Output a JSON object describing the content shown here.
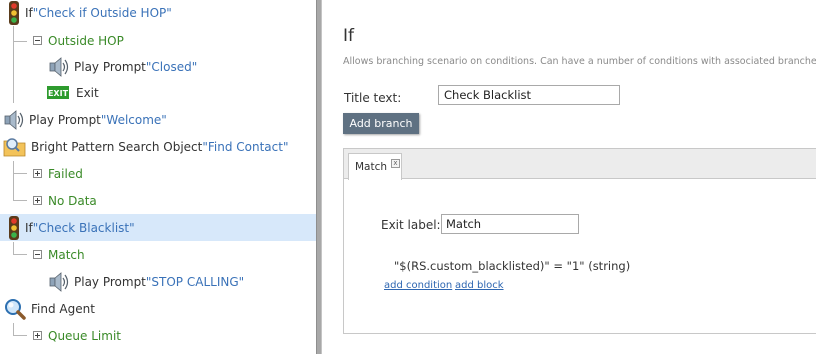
{
  "tree": {
    "rows": [
      {
        "prefix": "If ",
        "name": "\"Check if Outside HOP\"",
        "icon": "traffic-light-icon"
      },
      {
        "label": "Outside HOP",
        "icon": "collapse-icon"
      },
      {
        "prefix": "Play Prompt ",
        "name": "\"Closed\"",
        "icon": "speaker-icon"
      },
      {
        "prefix": "Exit",
        "icon": "exit-icon",
        "icon_text": "EXIT"
      },
      {
        "prefix": "Play Prompt ",
        "name": "\"Welcome\"",
        "icon": "speaker-icon"
      },
      {
        "prefix": "Bright Pattern Search Object ",
        "name": "\"Find Contact\"",
        "icon": "search-folder-icon"
      },
      {
        "label": "Failed",
        "icon": "expand-icon"
      },
      {
        "label": "No Data",
        "icon": "expand-icon"
      },
      {
        "prefix": "If ",
        "name": "\"Check Blacklist\"",
        "icon": "traffic-light-icon",
        "selected": true
      },
      {
        "label": "Match",
        "icon": "collapse-icon"
      },
      {
        "prefix": "Play Prompt ",
        "name": "\"STOP CALLING\"",
        "icon": "speaker-icon"
      },
      {
        "prefix": "Find Agent",
        "icon": "magnifier-icon"
      },
      {
        "label": "Queue Limit",
        "icon": "expand-icon"
      }
    ]
  },
  "props": {
    "title": "If",
    "description": "Allows branching scenario on conditions. Can have a number of conditions with associated branches.",
    "title_text_label": "Title text:",
    "title_text_value": "Check Blacklist",
    "add_branch_label": "Add branch",
    "tab_label": "Match",
    "tab_close": "x",
    "exit_label": "Exit label:",
    "exit_value": "Match",
    "condition": "\"$(RS.custom_blacklisted)\" = \"1\" (string)",
    "add_condition": "add condition",
    "add_block": "add block"
  }
}
